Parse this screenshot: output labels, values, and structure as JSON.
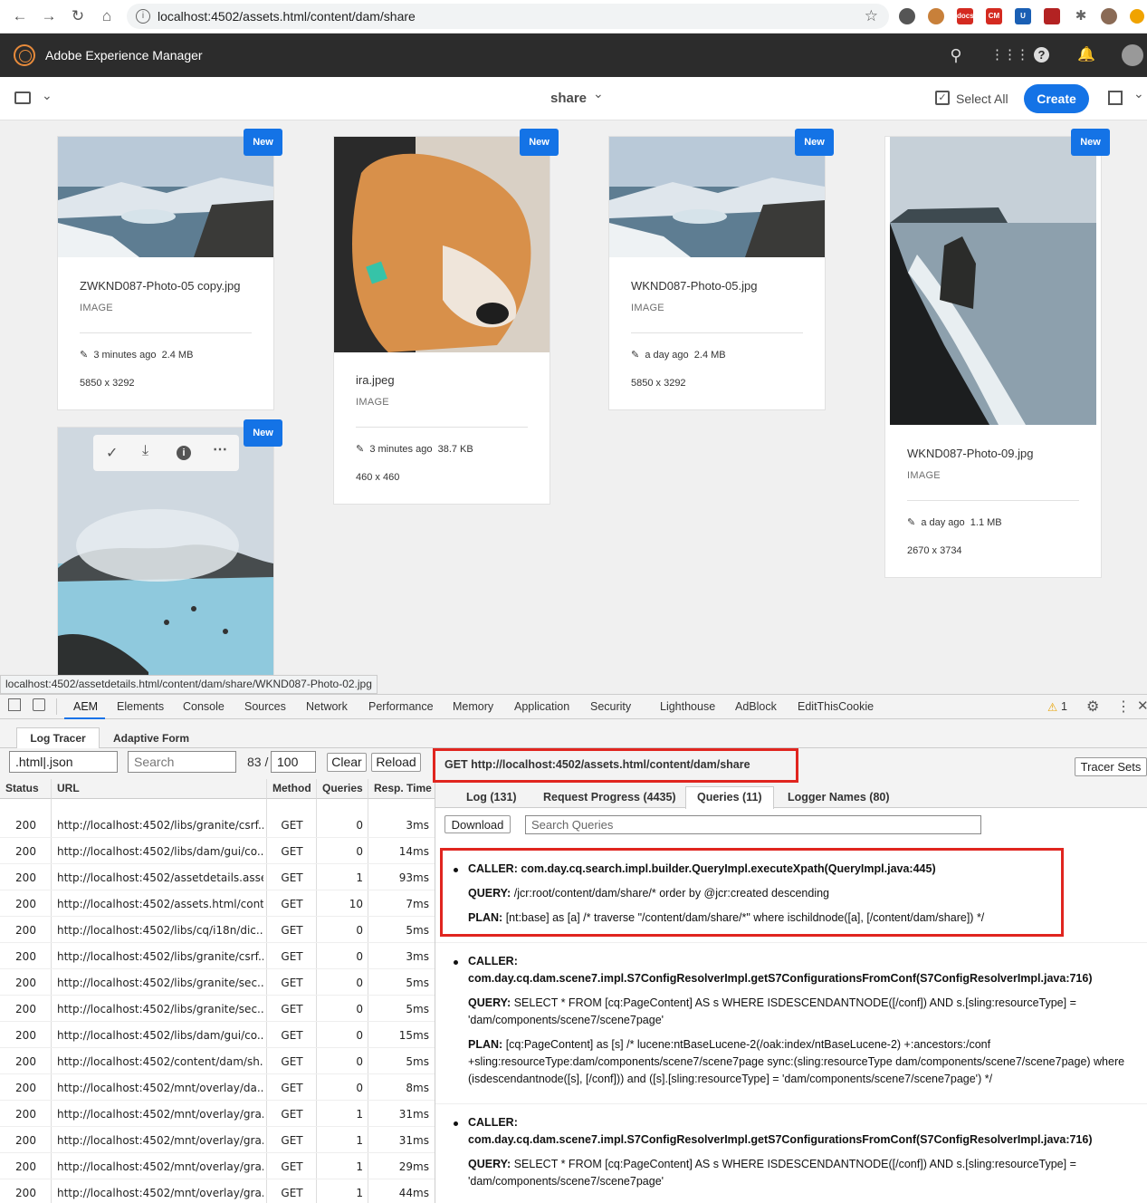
{
  "browser": {
    "url": "localhost:4502/assets.html/content/dam/share",
    "extensions": [
      "docs",
      "CM"
    ]
  },
  "aem": {
    "title": "Adobe Experience Manager",
    "folder": "share",
    "select_all": "Select All",
    "create": "Create"
  },
  "cards": [
    {
      "badge": "New",
      "name": "ZWKND087-Photo-05 copy.jpg",
      "type": "IMAGE",
      "modified": "3 minutes ago",
      "size": "2.4 MB",
      "dims": "5850 x 3292"
    },
    {
      "badge": "New",
      "name": "ira.jpeg",
      "type": "IMAGE",
      "modified": "3 minutes ago",
      "size": "38.7 KB",
      "dims": "460 x 460"
    },
    {
      "badge": "New",
      "name": "WKND087-Photo-05.jpg",
      "type": "IMAGE",
      "modified": "a day ago",
      "size": "2.4 MB",
      "dims": "5850 x 3292"
    },
    {
      "badge": "New",
      "name": "WKND087-Photo-09.jpg",
      "type": "IMAGE",
      "modified": "a day ago",
      "size": "1.1 MB",
      "dims": "2670 x 3734"
    },
    {
      "badge": "New"
    }
  ],
  "status_url": "localhost:4502/assetdetails.html/content/dam/share/WKND087-Photo-02.jpg",
  "devtools": {
    "tabs": [
      "AEM",
      "Elements",
      "Console",
      "Sources",
      "Network",
      "Performance",
      "Memory",
      "Application",
      "Security",
      "Lighthouse",
      "AdBlock",
      "EditThisCookie"
    ],
    "warnings": "1"
  },
  "aem_tabs": [
    "Log Tracer",
    "Adaptive Form"
  ],
  "filter": {
    "value": ".html|.json",
    "search_placeholder": "Search",
    "count": "83 /",
    "limit": "100",
    "clear": "Clear",
    "reload": "Reload"
  },
  "table": {
    "headers": [
      "Status",
      "URL",
      "Method",
      "Queries",
      "Resp. Time"
    ],
    "rows": [
      [
        "200",
        "http://localhost:4502/libs/granite/csrf...",
        "GET",
        "0",
        "3ms"
      ],
      [
        "200",
        "http://localhost:4502/libs/dam/gui/co...",
        "GET",
        "0",
        "14ms"
      ],
      [
        "200",
        "http://localhost:4502/assetdetails.asse...",
        "GET",
        "1",
        "93ms"
      ],
      [
        "200",
        "http://localhost:4502/assets.html/cont...",
        "GET",
        "10",
        "7ms"
      ],
      [
        "200",
        "http://localhost:4502/libs/cq/i18n/dic...",
        "GET",
        "0",
        "5ms"
      ],
      [
        "200",
        "http://localhost:4502/libs/granite/csrf...",
        "GET",
        "0",
        "3ms"
      ],
      [
        "200",
        "http://localhost:4502/libs/granite/sec...",
        "GET",
        "0",
        "5ms"
      ],
      [
        "200",
        "http://localhost:4502/libs/granite/sec...",
        "GET",
        "0",
        "5ms"
      ],
      [
        "200",
        "http://localhost:4502/libs/dam/gui/co...",
        "GET",
        "0",
        "15ms"
      ],
      [
        "200",
        "http://localhost:4502/content/dam/sh...",
        "GET",
        "0",
        "5ms"
      ],
      [
        "200",
        "http://localhost:4502/mnt/overlay/da...",
        "GET",
        "0",
        "8ms"
      ],
      [
        "200",
        "http://localhost:4502/mnt/overlay/gra...",
        "GET",
        "1",
        "31ms"
      ],
      [
        "200",
        "http://localhost:4502/mnt/overlay/gra...",
        "GET",
        "1",
        "31ms"
      ],
      [
        "200",
        "http://localhost:4502/mnt/overlay/gra...",
        "GET",
        "1",
        "29ms"
      ],
      [
        "200",
        "http://localhost:4502/mnt/overlay/gra...",
        "GET",
        "1",
        "44ms"
      ]
    ]
  },
  "request": "GET http://localhost:4502/assets.html/content/dam/share",
  "tracer_sets": "Tracer Sets",
  "right_tabs": [
    "Log (131)",
    "Request Progress (4435)",
    "Queries (11)",
    "Logger Names (80)"
  ],
  "download": "Download",
  "search_queries": "Search Queries",
  "queries": [
    {
      "caller_label": "CALLER:",
      "caller": "com.day.cq.search.impl.builder.QueryImpl.executeXpath(QueryImpl.java:445)",
      "query_label": "QUERY:",
      "query": "/jcr:root/content/dam/share/* order by @jcr:created descending",
      "plan_label": "PLAN:",
      "plan": "[nt:base] as [a] /* traverse \"/content/dam/share/*\" where ischildnode([a], [/content/dam/share]) */"
    },
    {
      "caller_label": "CALLER:",
      "caller": "com.day.cq.dam.scene7.impl.S7ConfigResolverImpl.getS7ConfigurationsFromConf(S7ConfigResolverImpl.java:716)",
      "query_label": "QUERY:",
      "query_1": "SELECT * FROM [cq:PageContent] AS s WHERE ISDESCENDANTNODE([/conf]) AND s.[sling:resourceType] =",
      "query_2": "'dam/components/scene7/scene7page'",
      "plan_label": "PLAN:",
      "plan_1": "[cq:PageContent] as [s] /* lucene:ntBaseLucene-2(/oak:index/ntBaseLucene-2) +:ancestors:/conf",
      "plan_2": "+sling:resourceType:dam/components/scene7/scene7page sync:(sling:resourceType dam/components/scene7/scene7page) where",
      "plan_3": "(isdescendantnode([s], [/conf])) and ([s].[sling:resourceType] = 'dam/components/scene7/scene7page') */"
    },
    {
      "caller_label": "CALLER:",
      "caller": "com.day.cq.dam.scene7.impl.S7ConfigResolverImpl.getS7ConfigurationsFromConf(S7ConfigResolverImpl.java:716)",
      "query_label": "QUERY:",
      "query_1": "SELECT * FROM [cq:PageContent] AS s WHERE ISDESCENDANTNODE([/conf]) AND s.[sling:resourceType] =",
      "query_2": "'dam/components/scene7/scene7page'"
    }
  ]
}
